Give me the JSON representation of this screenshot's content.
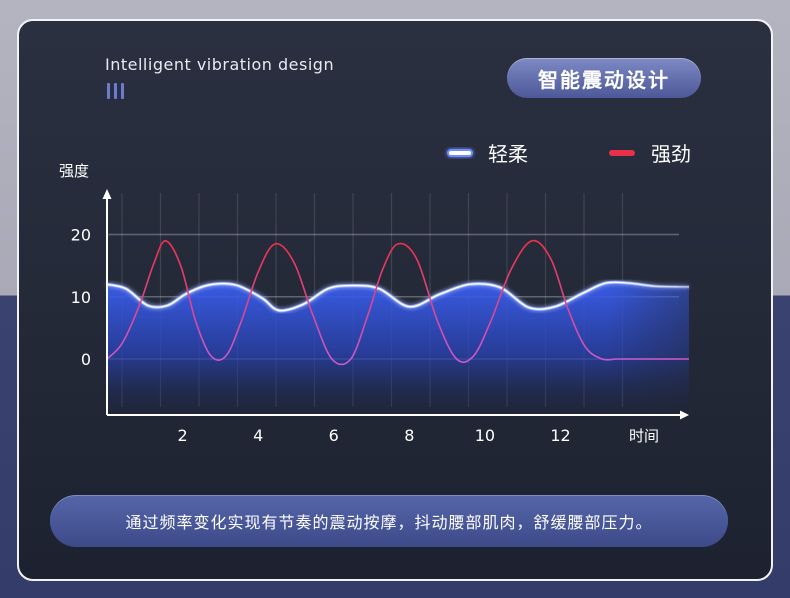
{
  "header": {
    "en_title": "Intelligent vibration design",
    "badge": "智能震动设计"
  },
  "caption": "通过频率变化实现有节奏的震动按摩，抖动腰部肌肉，舒缓腰部压力。",
  "colors": {
    "gentle": "#4f78ff",
    "strong": "#e8304a",
    "accent": "#6c7bd0"
  },
  "chart_data": {
    "type": "line",
    "title": "",
    "ylabel": "强度",
    "xlabel": "时间",
    "xlim": [
      0,
      15.4
    ],
    "ylim": [
      -9,
      27
    ],
    "y_ticks": [
      "0",
      "10",
      "20"
    ],
    "y_tick_values": [
      0,
      10,
      20
    ],
    "x_ticks": [
      "2",
      "4",
      "6",
      "8",
      "10",
      "12"
    ],
    "x_tick_values": [
      2,
      4,
      6,
      8,
      10,
      12
    ],
    "grid": true,
    "legend_position": "top-right",
    "series": [
      {
        "name": "轻柔",
        "color": "#4f78ff",
        "fill": true,
        "x": [
          0,
          0.5,
          1.08,
          1.6,
          2.1,
          2.7,
          3.4,
          4.1,
          4.55,
          5.2,
          5.85,
          6.5,
          7.2,
          8.0,
          8.8,
          9.6,
          10.4,
          11.15,
          11.85,
          12.6,
          13.2,
          13.8,
          14.5,
          15.2,
          15.4
        ],
        "y": [
          12,
          11.3,
          8.6,
          8.6,
          10.5,
          11.9,
          11.9,
          9.8,
          7.8,
          8.8,
          11.3,
          11.8,
          11.3,
          8.4,
          10.4,
          12,
          11.5,
          8.3,
          8.4,
          10.6,
          12.2,
          12.2,
          11.7,
          11.6,
          11.6
        ]
      },
      {
        "name": "强劲",
        "color": "#e8304a",
        "fill": false,
        "x": [
          0,
          0.4,
          0.85,
          1.25,
          1.55,
          1.95,
          2.35,
          2.75,
          3.15,
          3.55,
          4.0,
          4.45,
          4.95,
          5.45,
          5.95,
          6.45,
          6.9,
          7.3,
          7.7,
          8.2,
          8.75,
          9.25,
          9.7,
          10.15,
          10.7,
          11.25,
          11.75,
          12.2,
          12.65,
          13.1,
          13.5,
          14.0,
          14.5,
          15.4
        ],
        "y": [
          0,
          2.5,
          8.5,
          15.5,
          19,
          15,
          6,
          0.5,
          0.5,
          6,
          14,
          18.5,
          15.5,
          7,
          0,
          0,
          7,
          14.5,
          18.5,
          16,
          6,
          0,
          0.5,
          6,
          14.5,
          19,
          16,
          8,
          2,
          0,
          0,
          0,
          0,
          0
        ]
      }
    ]
  }
}
